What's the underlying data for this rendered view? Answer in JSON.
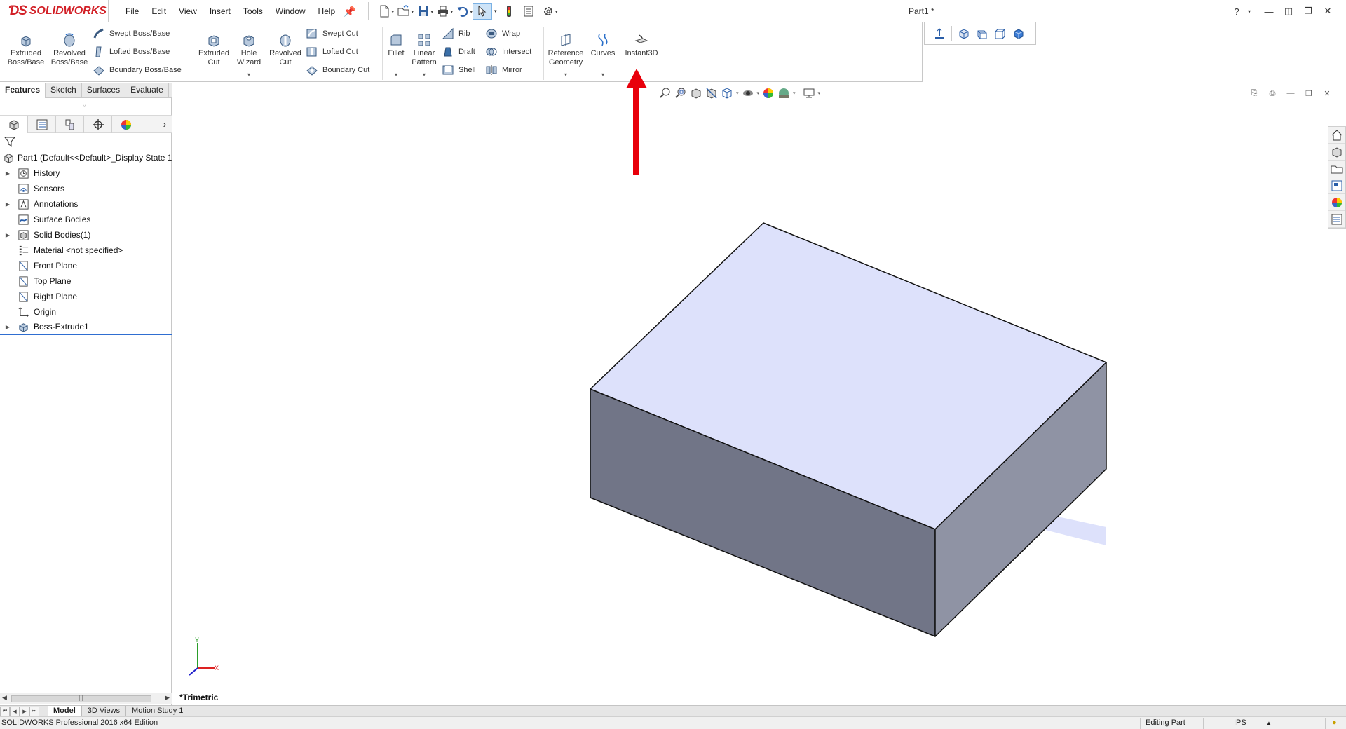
{
  "app": {
    "brand_ds": "ƊS",
    "brand_name": "SOLIDWORKS",
    "document_title": "Part1 *"
  },
  "menu": [
    "File",
    "Edit",
    "View",
    "Insert",
    "Tools",
    "Window",
    "Help"
  ],
  "ribbon": {
    "extruded_boss": "Extruded Boss/Base",
    "revolved_boss": "Revolved Boss/Base",
    "swept_boss": "Swept Boss/Base",
    "lofted_boss": "Lofted Boss/Base",
    "boundary_boss": "Boundary Boss/Base",
    "extruded_cut": "Extruded Cut",
    "hole_wizard": "Hole Wizard",
    "revolved_cut": "Revolved Cut",
    "swept_cut": "Swept Cut",
    "lofted_cut": "Lofted Cut",
    "boundary_cut": "Boundary Cut",
    "fillet": "Fillet",
    "linear_pattern": "Linear Pattern",
    "rib": "Rib",
    "draft": "Draft",
    "shell": "Shell",
    "wrap": "Wrap",
    "intersect": "Intersect",
    "mirror": "Mirror",
    "reference_geometry": "Reference Geometry",
    "curves": "Curves",
    "instant3d": "Instant3D"
  },
  "command_tabs": [
    "Features",
    "Sketch",
    "Surfaces",
    "Evaluate"
  ],
  "tree": {
    "root": "Part1  (Default<<Default>_Display State 1",
    "items": [
      {
        "label": "History",
        "expandable": true,
        "icon": "history-icon"
      },
      {
        "label": "Sensors",
        "expandable": false,
        "icon": "sensors-icon"
      },
      {
        "label": "Annotations",
        "expandable": true,
        "icon": "annotations-icon"
      },
      {
        "label": "Surface Bodies",
        "expandable": false,
        "icon": "surface-bodies-icon"
      },
      {
        "label": "Solid Bodies(1)",
        "expandable": true,
        "icon": "solid-bodies-icon"
      },
      {
        "label": "Material <not specified>",
        "expandable": false,
        "icon": "material-icon"
      },
      {
        "label": "Front Plane",
        "expandable": false,
        "icon": "plane-icon"
      },
      {
        "label": "Top Plane",
        "expandable": false,
        "icon": "plane-icon"
      },
      {
        "label": "Right Plane",
        "expandable": false,
        "icon": "plane-icon"
      },
      {
        "label": "Origin",
        "expandable": false,
        "icon": "origin-icon"
      },
      {
        "label": "Boss-Extrude1",
        "expandable": true,
        "icon": "boss-extrude-icon"
      }
    ]
  },
  "viewport": {
    "view_name": "*Trimetric",
    "triad_x": "X",
    "triad_y": "Y"
  },
  "bottom_tabs": [
    "Model",
    "3D Views",
    "Motion Study 1"
  ],
  "status": {
    "edition": "SOLIDWORKS Professional 2016 x64 Edition",
    "mode": "Editing Part",
    "units": "IPS"
  },
  "colors": {
    "accent": "#d21f26",
    "annotation_arrow": "#e8000b",
    "top_face": "#dde1fb",
    "front_face": "#717587",
    "side_face": "#8f93a4"
  }
}
